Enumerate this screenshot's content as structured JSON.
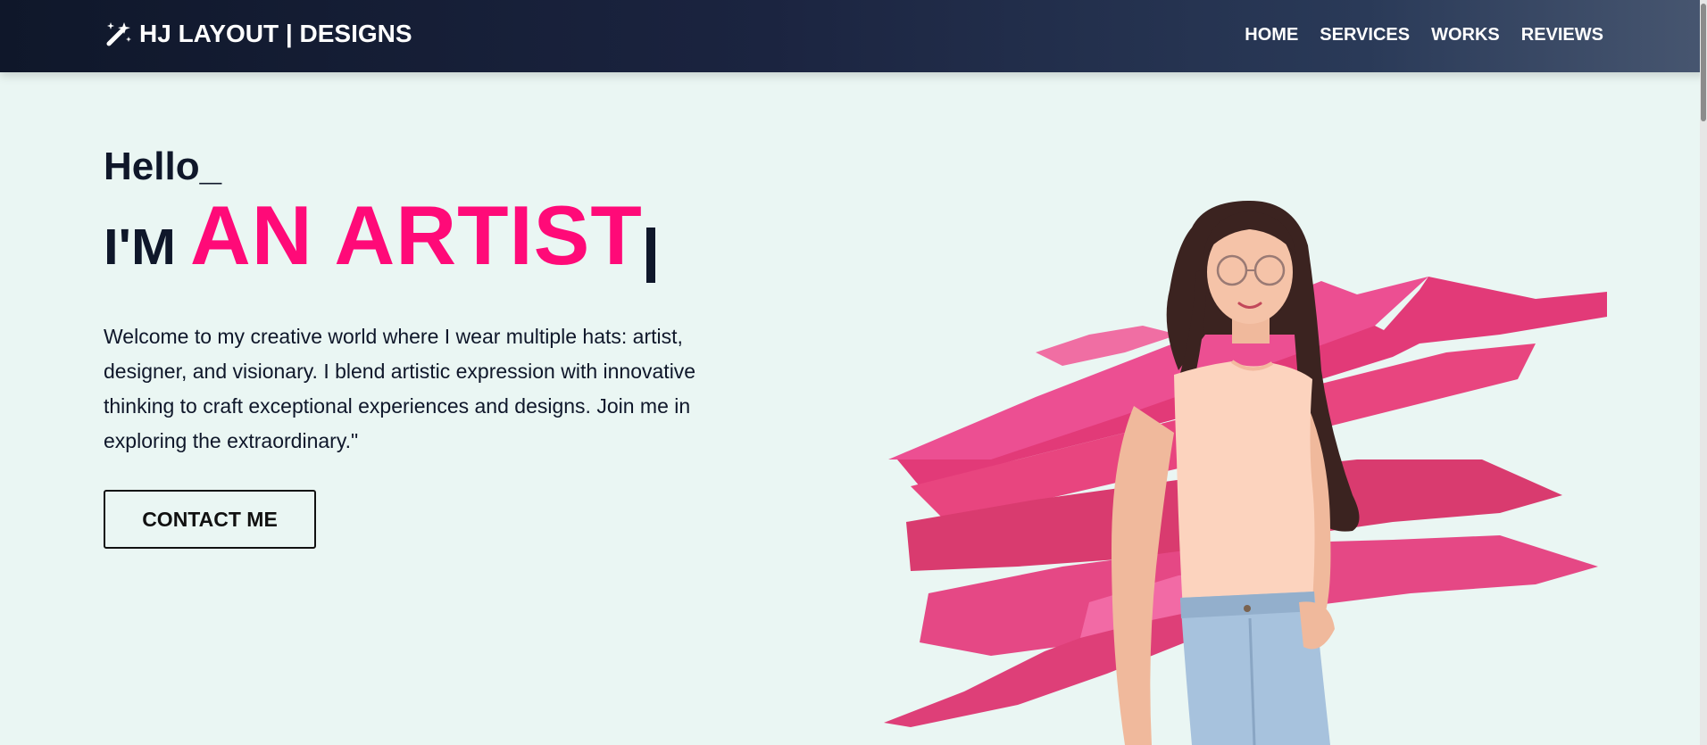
{
  "nav": {
    "brand": "HJ LAYOUT | DESIGNS",
    "brand_icon": "magic-wand-icon",
    "links": [
      "HOME",
      "SERVICES",
      "WORKS",
      "REVIEWS"
    ]
  },
  "hero": {
    "greeting": "Hello_",
    "prefix": "I'M",
    "role": "AN ARTIST",
    "intro": "Welcome to my creative world where I wear multiple hats: artist, designer, and visionary. I blend artistic expression with innovative thinking to craft exceptional experiences and designs. Join me in exploring the extraordinary.\"",
    "cta": "CONTACT ME"
  },
  "colors": {
    "accent": "#ff0a78",
    "navbar_start": "#0f172a",
    "navbar_end": "#475670",
    "background": "#eaf6f3",
    "text": "#0f172a"
  }
}
